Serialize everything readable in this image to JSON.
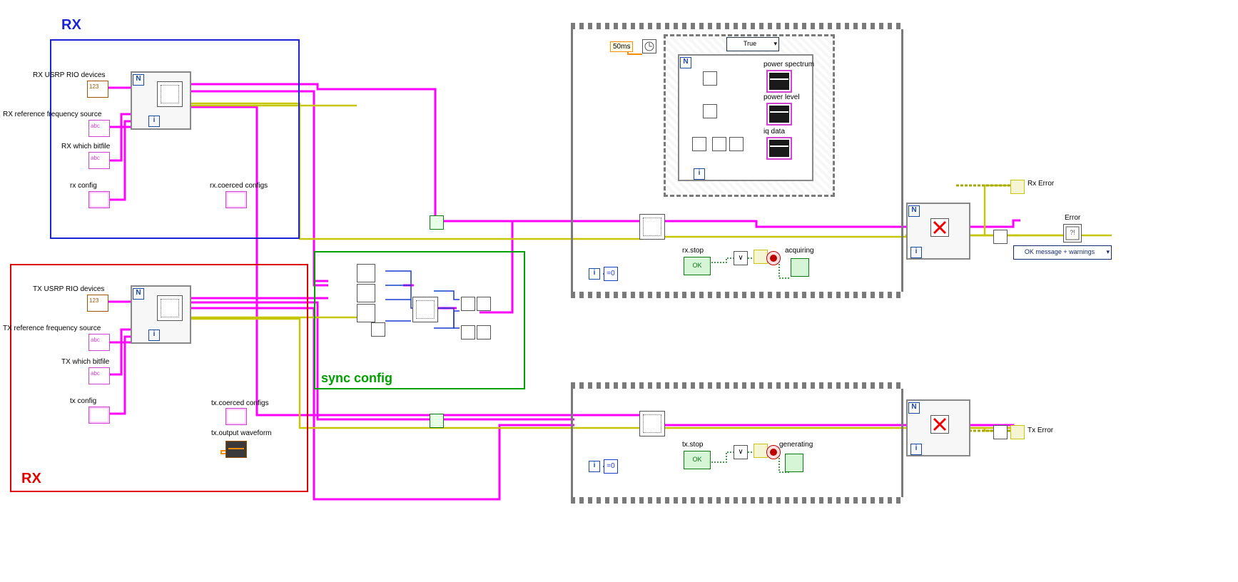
{
  "labels": {
    "rx_title": "RX",
    "tx_title": "RX",
    "sync_title": "sync config",
    "rx_usrp_devices": "RX USRP RIO devices",
    "rx_ref_freq": "RX reference frequency source",
    "rx_which_bitfile": "RX which bitfile",
    "rx_config": "rx config",
    "rx_coerced_configs": "rx.coerced configs",
    "tx_usrp_devices": "TX USRP RIO devices",
    "tx_ref_freq": "TX reference frequency source",
    "tx_which_bitfile": "TX which bitfile",
    "tx_config": "tx config",
    "tx_coerced_configs": "tx.coerced configs",
    "tx_output_waveform": "tx.output waveform",
    "power_spectrum": "power spectrum",
    "power_level": "power level",
    "iq_data": "iq data",
    "rx_stop": "rx.stop",
    "tx_stop": "tx.stop",
    "acquiring": "acquiring",
    "generating": "generating",
    "rx_error": "Rx Error",
    "tx_error": "Tx Error",
    "error": "Error",
    "wait_ms": "50ms",
    "case_sel": "True",
    "soft_dlg": "OK message + warnings"
  }
}
